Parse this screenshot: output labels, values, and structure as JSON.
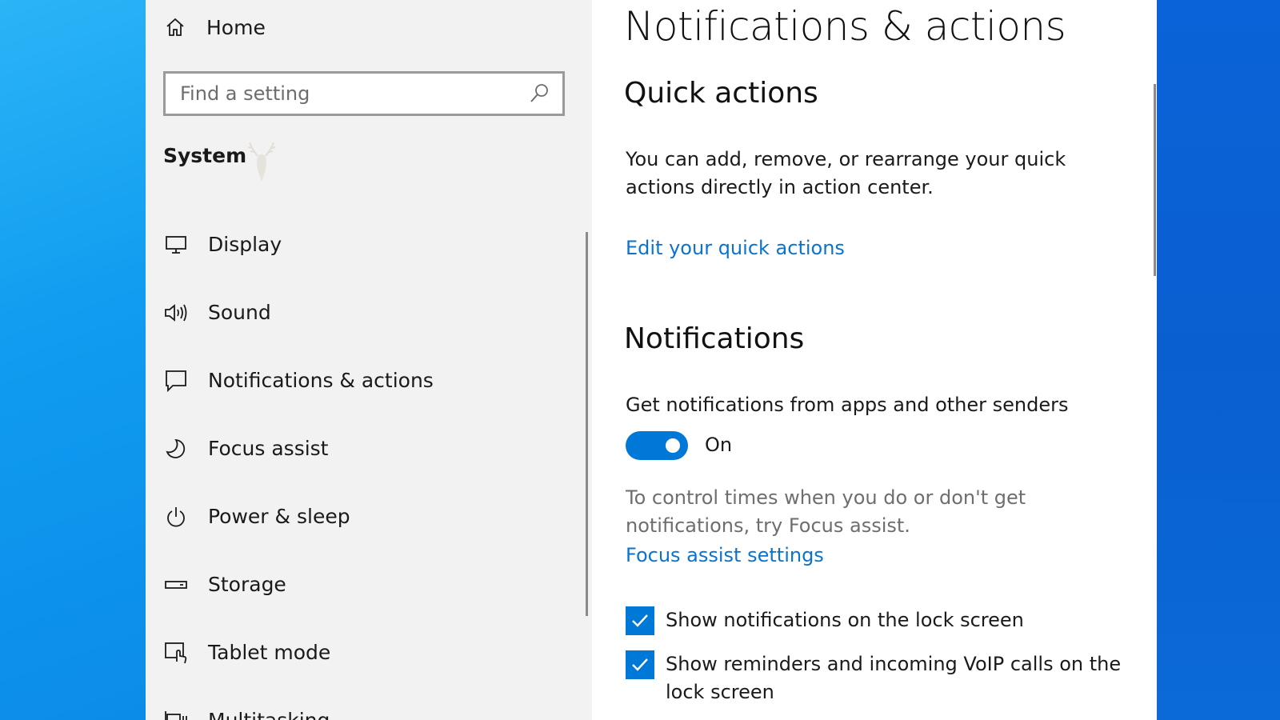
{
  "sidebar": {
    "home_label": "Home",
    "search_placeholder": "Find a setting",
    "section_title": "System",
    "items": [
      {
        "label": "Display",
        "icon": "monitor-icon"
      },
      {
        "label": "Sound",
        "icon": "speaker-icon"
      },
      {
        "label": "Notifications & actions",
        "icon": "notification-icon"
      },
      {
        "label": "Focus assist",
        "icon": "moon-icon"
      },
      {
        "label": "Power & sleep",
        "icon": "power-icon"
      },
      {
        "label": "Storage",
        "icon": "storage-icon"
      },
      {
        "label": "Tablet mode",
        "icon": "tablet-mode-icon"
      },
      {
        "label": "Multitasking",
        "icon": "multitasking-icon"
      }
    ]
  },
  "content": {
    "page_title": "Notifications & actions",
    "quick_actions": {
      "heading": "Quick actions",
      "description": "You can add, remove, or rearrange your quick actions directly in action center.",
      "link": "Edit your quick actions"
    },
    "notifications": {
      "heading": "Notifications",
      "toggle_caption": "Get notifications from apps and other senders",
      "toggle_state": "On",
      "focus_hint": "To control times when you do or don't get notifications, try Focus assist.",
      "focus_link": "Focus assist settings",
      "checkboxes": [
        {
          "label": "Show notifications on the lock screen",
          "checked": true
        },
        {
          "label": "Show reminders and incoming VoIP calls on the lock screen",
          "checked": true
        }
      ]
    }
  },
  "colors": {
    "accent": "#0078d7",
    "link": "#0a73cc",
    "sidebar_bg": "#f2f2f2"
  }
}
